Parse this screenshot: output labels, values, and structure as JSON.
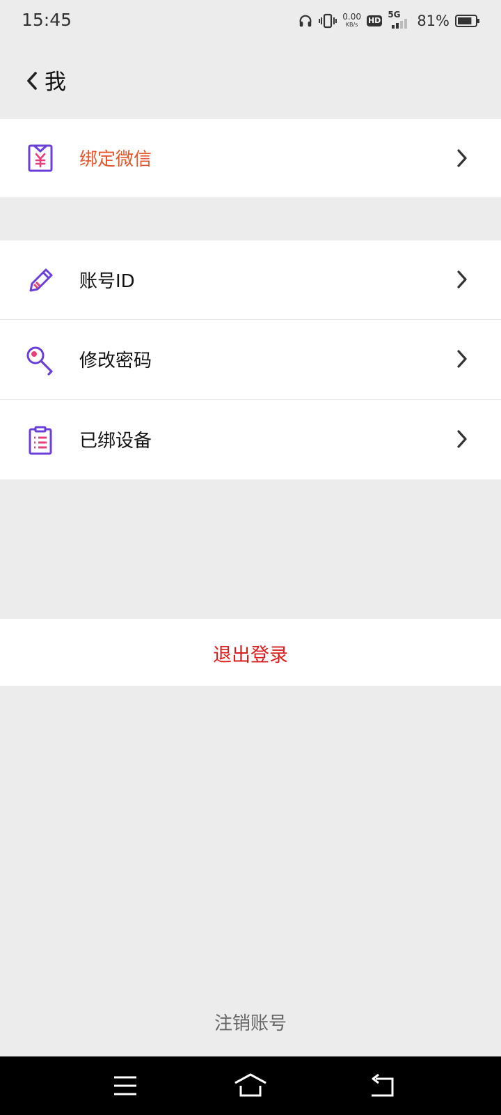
{
  "status_bar": {
    "time": "15:45",
    "net_speed_value": "0.00",
    "net_speed_unit": "KB/s",
    "hd": "HD",
    "network": "5G",
    "battery": "81%",
    "battery_level": 0.81
  },
  "nav": {
    "title": "我"
  },
  "menu": {
    "bind_wechat": "绑定微信",
    "account_id": "账号ID",
    "change_password": "修改密码",
    "bound_devices": "已绑设备"
  },
  "actions": {
    "logout": "退出登录",
    "cancel_account": "注销账号"
  },
  "colors": {
    "accent_orange": "#e4572e",
    "danger_red": "#d81e1e",
    "icon_purple": "#6a3fd8",
    "icon_pink": "#e6407a"
  }
}
